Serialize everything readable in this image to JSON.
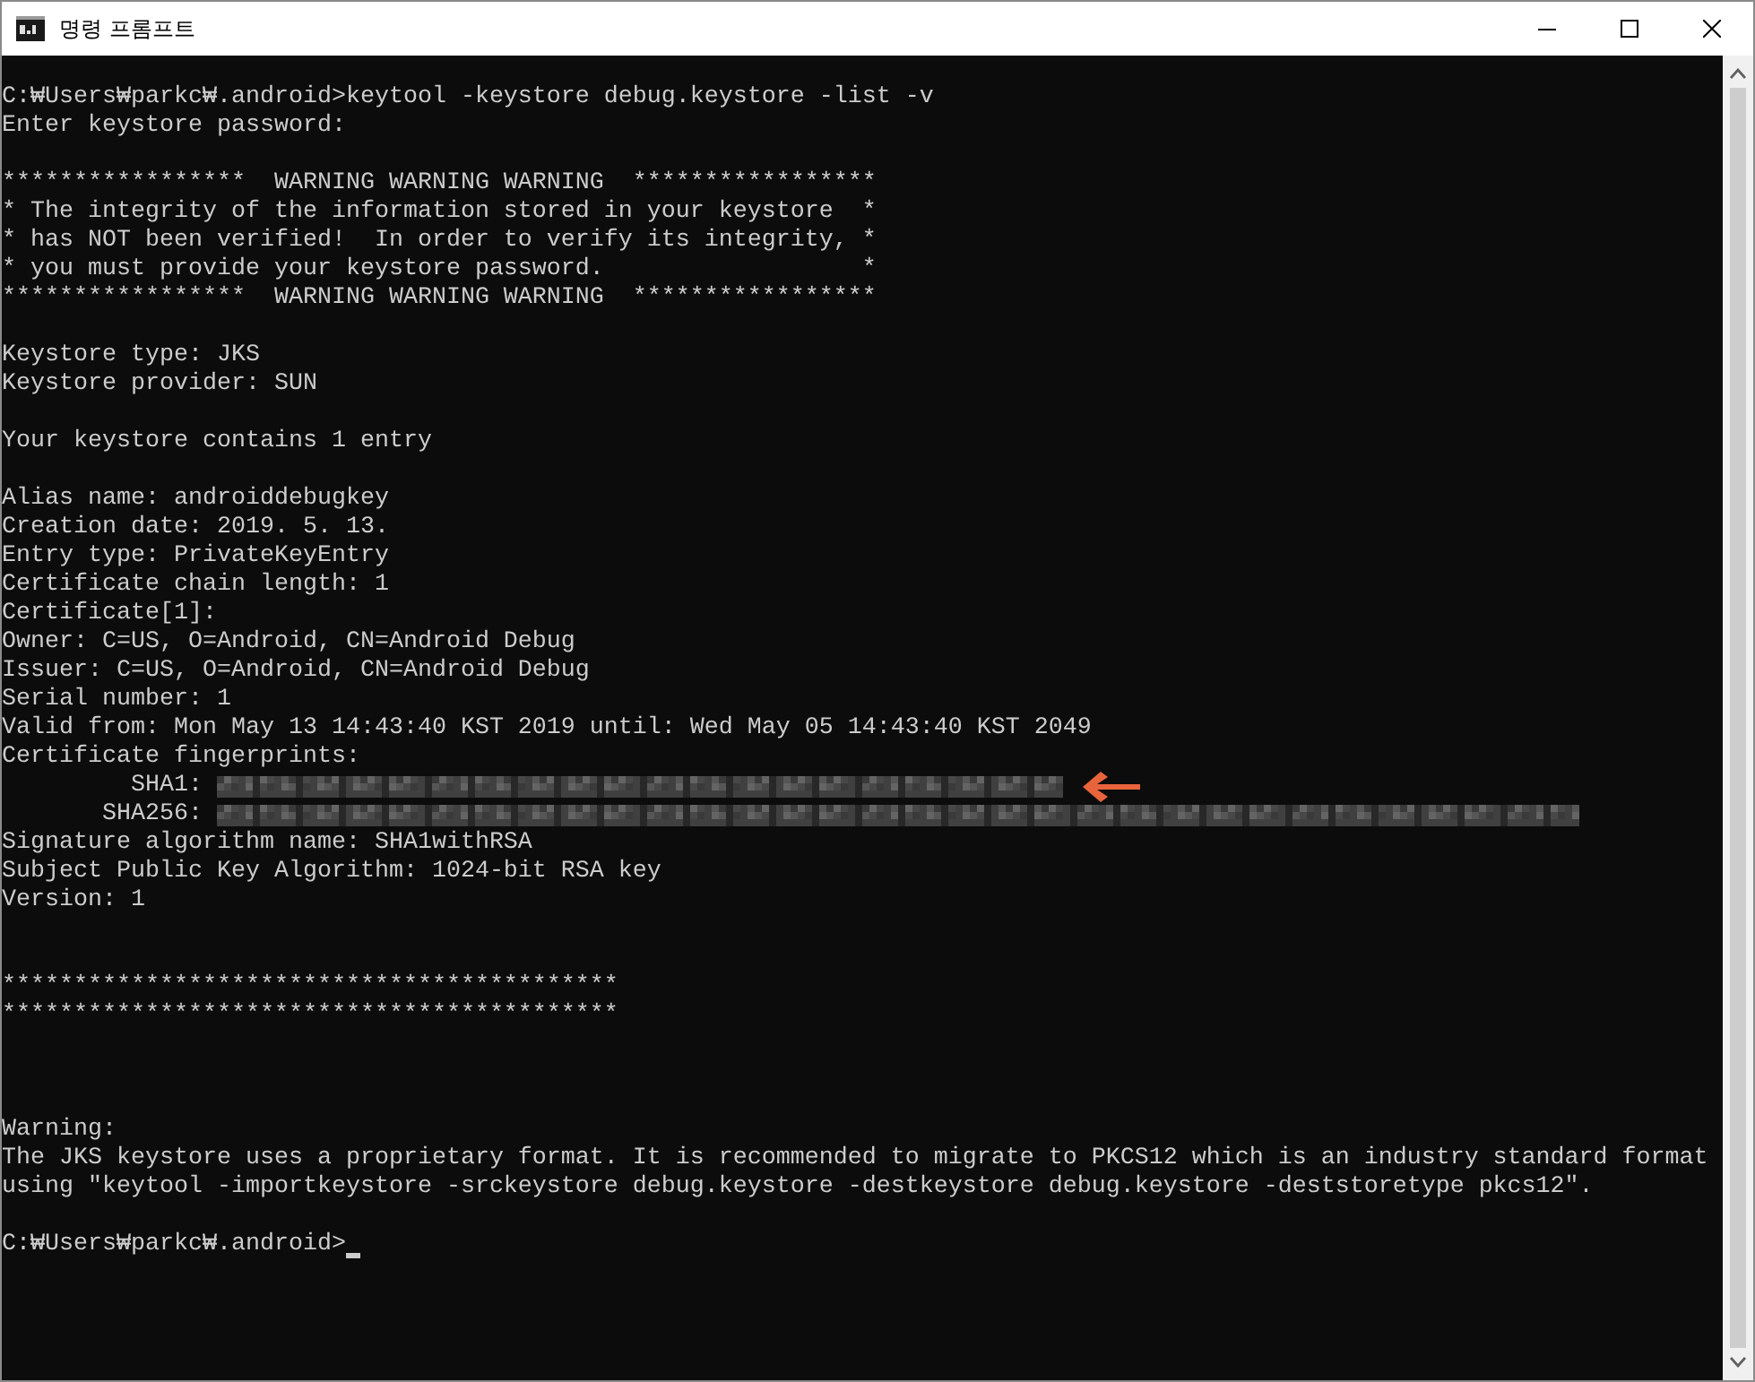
{
  "window": {
    "title": "명령 프롬프트",
    "controls": [
      {
        "kind": "minimize"
      },
      {
        "kind": "maximize"
      },
      {
        "kind": "close"
      }
    ]
  },
  "console": {
    "lines": [
      {
        "kind": "text",
        "text": "C:₩Users₩parkc₩.android>keytool -keystore debug.keystore -list -v"
      },
      {
        "kind": "text",
        "text": "Enter keystore password:"
      },
      {
        "kind": "blank"
      },
      {
        "kind": "text",
        "text": "*****************  WARNING WARNING WARNING  *****************"
      },
      {
        "kind": "text",
        "text": "* The integrity of the information stored in your keystore  *"
      },
      {
        "kind": "text",
        "text": "* has NOT been verified!  In order to verify its integrity, *"
      },
      {
        "kind": "text",
        "text": "* you must provide your keystore password.                  *"
      },
      {
        "kind": "text",
        "text": "*****************  WARNING WARNING WARNING  *****************"
      },
      {
        "kind": "blank"
      },
      {
        "kind": "text",
        "text": "Keystore type: JKS"
      },
      {
        "kind": "text",
        "text": "Keystore provider: SUN"
      },
      {
        "kind": "blank"
      },
      {
        "kind": "text",
        "text": "Your keystore contains 1 entry"
      },
      {
        "kind": "blank"
      },
      {
        "kind": "text",
        "text": "Alias name: androiddebugkey"
      },
      {
        "kind": "text",
        "text": "Creation date: 2019. 5. 13."
      },
      {
        "kind": "text",
        "text": "Entry type: PrivateKeyEntry"
      },
      {
        "kind": "text",
        "text": "Certificate chain length: 1"
      },
      {
        "kind": "text",
        "text": "Certificate[1]:"
      },
      {
        "kind": "text",
        "text": "Owner: C=US, O=Android, CN=Android Debug"
      },
      {
        "kind": "text",
        "text": "Issuer: C=US, O=Android, CN=Android Debug"
      },
      {
        "kind": "text",
        "text": "Serial number: 1"
      },
      {
        "kind": "text",
        "text": "Valid from: Mon May 13 14:43:40 KST 2019 until: Wed May 05 14:43:40 KST 2049"
      },
      {
        "kind": "text",
        "text": "Certificate fingerprints:"
      },
      {
        "kind": "shortfingerprint",
        "label": "SHA1:",
        "marked": true
      },
      {
        "kind": "longfingerprint",
        "label": "SHA256:",
        "marked": false
      },
      {
        "kind": "text",
        "text": "Signature algorithm name: SHA1withRSA"
      },
      {
        "kind": "text",
        "text": "Subject Public Key Algorithm: 1024-bit RSA key"
      },
      {
        "kind": "text",
        "text": "Version: 1"
      },
      {
        "kind": "blank"
      },
      {
        "kind": "blank"
      },
      {
        "kind": "text",
        "text": "*******************************************"
      },
      {
        "kind": "text",
        "text": "*******************************************"
      },
      {
        "kind": "blank"
      },
      {
        "kind": "blank"
      },
      {
        "kind": "blank"
      },
      {
        "kind": "text",
        "text": "Warning:"
      },
      {
        "kind": "text",
        "text": "The JKS keystore uses a proprietary format. It is recommended to migrate to PKCS12 which is an industry standard format"
      },
      {
        "kind": "text",
        "text": "using \"keytool -importkeystore -srckeystore debug.keystore -destkeystore debug.keystore -deststoretype pkcs12\"."
      },
      {
        "kind": "blank"
      },
      {
        "kind": "prompt",
        "text": "C:₩Users₩parkc₩.android>",
        "cursor": true
      }
    ]
  }
}
